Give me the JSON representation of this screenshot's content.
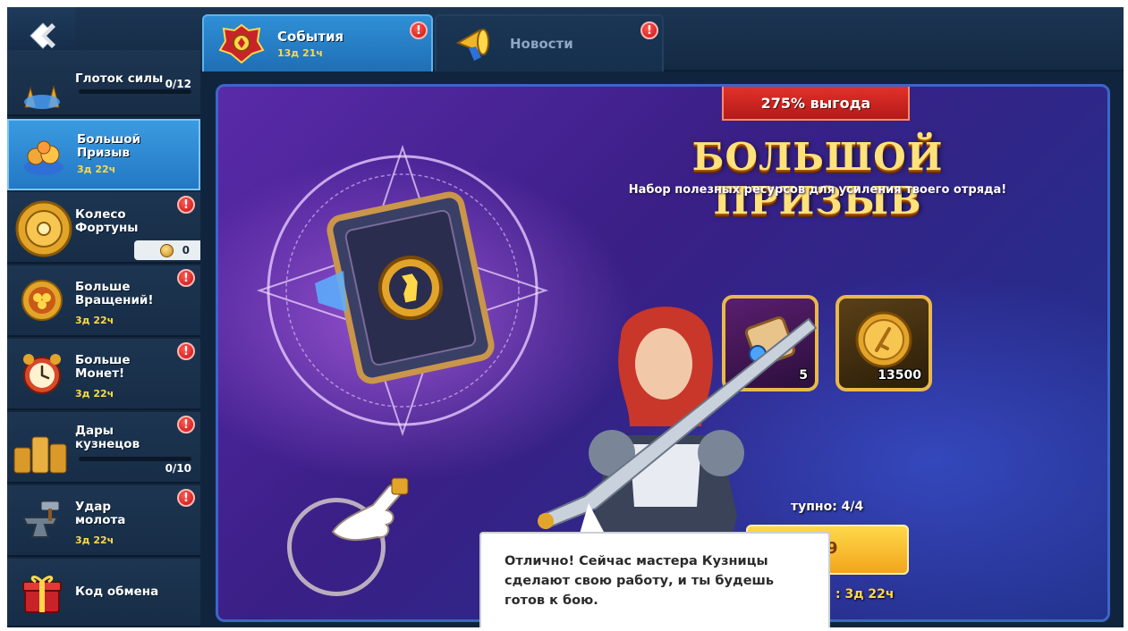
{
  "nav": {
    "back_icon": "back-arrow-icon"
  },
  "tabs": [
    {
      "title": "События",
      "timer": "13д 21ч",
      "icon": "crest-emblem-icon",
      "active": true,
      "alert": "!"
    },
    {
      "title": "Новости",
      "icon": "megaphone-icon",
      "active": false,
      "alert": "!"
    }
  ],
  "sidebar": {
    "items": [
      {
        "label": "Глоток силы",
        "progress": "0/12",
        "progress_fraction": 0,
        "icon": "potion-flasks-icon"
      },
      {
        "label": "Большой\nПризыв",
        "timer": "3д 22ч",
        "icon": "treasure-pile-icon",
        "active": true
      },
      {
        "label": "Колесо\nФортуны",
        "counter": "0",
        "icon": "fortune-wheel-icon",
        "alert": "!"
      },
      {
        "label": "Больше\nВращений!",
        "timer": "3д 22ч",
        "icon": "clover-token-icon",
        "alert": "!"
      },
      {
        "label": "Больше\nМонет!",
        "timer": "3д 22ч",
        "icon": "alarm-clock-icon",
        "alert": "!"
      },
      {
        "label": "Дары\nкузнецов",
        "progress": "0/10",
        "progress_fraction": 0,
        "icon": "coin-stacks-icon",
        "alert": "!"
      },
      {
        "label": "Удар\nмолота",
        "timer": "3д 22ч",
        "icon": "anvil-hammer-icon",
        "alert": "!"
      },
      {
        "label": "Код обмена",
        "icon": "gift-box-icon"
      }
    ]
  },
  "offer": {
    "ribbon": "275% выгода",
    "title": "БОЛЬШОЙ ПРИЗЫВ",
    "subtitle": "Набор полезных ресурсов для усиления твоего отряда!",
    "rewards": [
      {
        "qty": "5",
        "icon": "scroll-icon"
      },
      {
        "qty": "13500",
        "icon": "gold-coin-icon"
      }
    ],
    "available": "тупно: 4/4",
    "buy_label": "9",
    "timer": ": 3д 22ч"
  },
  "dialog": {
    "text": "Отлично! Сейчас мастера Кузницы сделают свою работу, и ты будешь готов к бою."
  },
  "colors": {
    "accent_blue": "#2f8fd6",
    "gold": "#ffd84a",
    "alert_red": "#d81b22",
    "ribbon_red": "#c9221f"
  }
}
